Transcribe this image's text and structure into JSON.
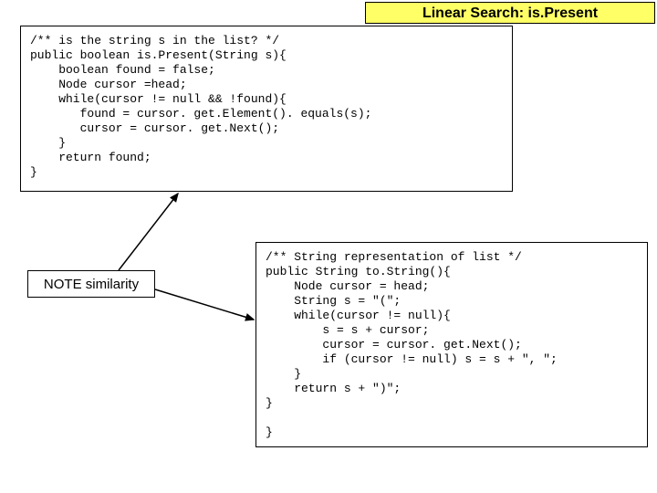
{
  "title": "Linear Search: is.Present",
  "note": "NOTE similarity",
  "code1": "/** is the string s in the list? */\npublic boolean is.Present(String s){\n    boolean found = false;\n    Node cursor =head;\n    while(cursor != null && !found){\n       found = cursor. get.Element(). equals(s);\n       cursor = cursor. get.Next();\n    }\n    return found;\n}",
  "code2": "/** String representation of list */\npublic String to.String(){\n    Node cursor = head;\n    String s = \"(\";\n    while(cursor != null){\n        s = s + cursor;\n        cursor = cursor. get.Next();\n        if (cursor != null) s = s + \", \";\n    }\n    return s + \")\";\n}\n\n}"
}
